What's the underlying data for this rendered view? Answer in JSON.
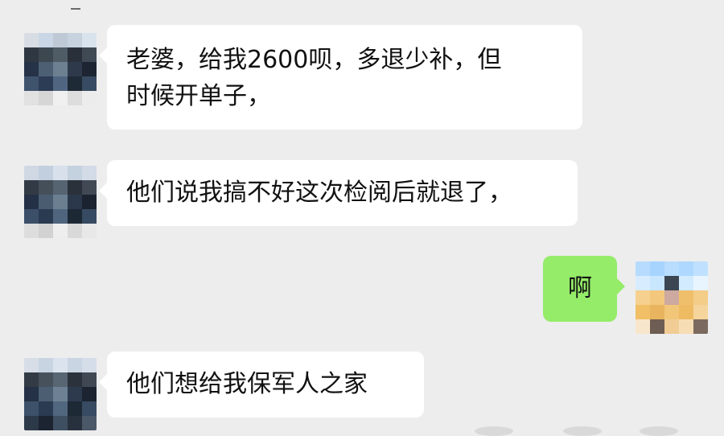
{
  "chat": {
    "messages": [
      {
        "side": "in",
        "text_lines": [
          "老婆，给我2600呗，多退少补，但",
          "时候开单子，"
        ]
      },
      {
        "side": "in",
        "text_lines": [
          "他们说我搞不好这次检阅后就退了，"
        ]
      },
      {
        "side": "out",
        "text_lines": [
          "啊"
        ]
      },
      {
        "side": "in",
        "text_lines": [
          "他们想给我保军人之家"
        ]
      }
    ]
  },
  "colors": {
    "background": "#ededed",
    "incoming_bubble": "#ffffff",
    "outgoing_bubble": "#95ec69"
  },
  "avatars": {
    "contact": "pixelated-avatar",
    "self": "pixelated-avatar"
  }
}
